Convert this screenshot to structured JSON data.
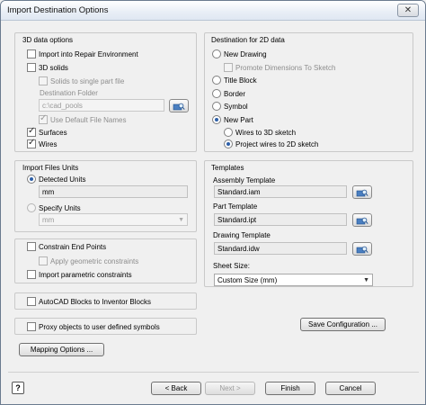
{
  "window": {
    "title": "Import Destination Options",
    "close_label": "✕"
  },
  "data3d": {
    "group_label": "3D data options",
    "import_repair": "Import into Repair Environment",
    "solids": "3D solids",
    "solids_single": "Solids to single part file",
    "dest_folder_label": "Destination Folder",
    "dest_folder_value": "c:\\cad_pools",
    "use_default_names": "Use Default File Names",
    "surfaces": "Surfaces",
    "wires": "Wires"
  },
  "dest2d": {
    "group_label": "Destination for 2D data",
    "new_drawing": "New Drawing",
    "promote_dims": "Promote Dimensions To Sketch",
    "title_block": "Title Block",
    "border": "Border",
    "symbol": "Symbol",
    "new_part": "New Part",
    "wires_3d": "Wires to 3D sketch",
    "project_2d": "Project wires to 2D sketch"
  },
  "units": {
    "group_label": "Import Files Units",
    "detected": "Detected Units",
    "detected_value": "mm",
    "specify": "Specify Units",
    "specify_value": "mm"
  },
  "templates": {
    "group_label": "Templates",
    "assembly_label": "Assembly Template",
    "assembly_value": "Standard.iam",
    "part_label": "Part Template",
    "part_value": "Standard.ipt",
    "drawing_label": "Drawing Template",
    "drawing_value": "Standard.idw",
    "sheet_label": "Sheet Size:",
    "sheet_value": "Custom Size (mm)"
  },
  "constraints": {
    "end_points": "Constrain End Points",
    "apply_geometric": "Apply geometric constraints",
    "parametric": "Import parametric constraints"
  },
  "autocad_blocks": "AutoCAD Blocks to Inventor Blocks",
  "proxy_objects": "Proxy objects to user defined symbols",
  "buttons": {
    "save_config": "Save Configuration ...",
    "mapping": "Mapping Options ...",
    "back": "< Back",
    "next": "Next >",
    "finish": "Finish",
    "cancel": "Cancel",
    "help": "?"
  }
}
